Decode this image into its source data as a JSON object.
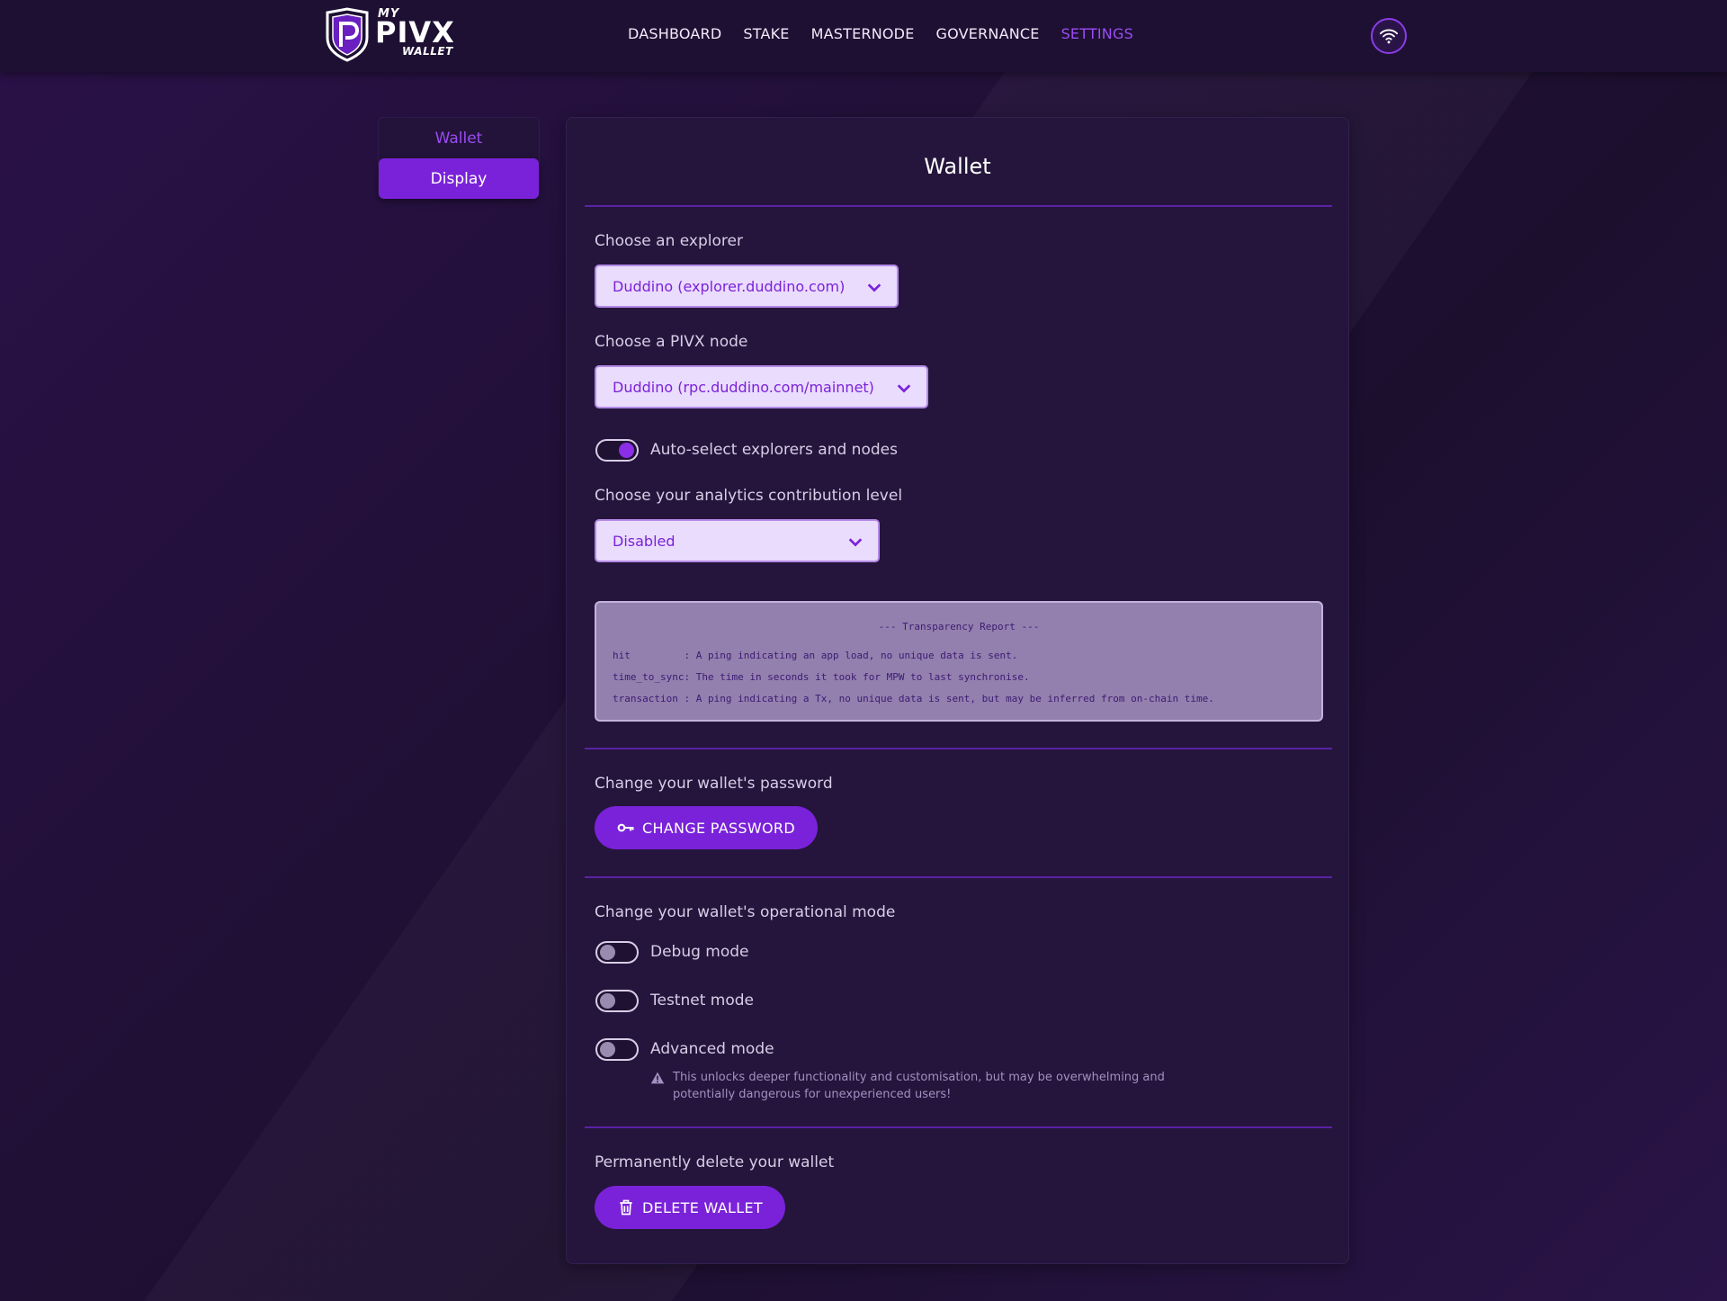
{
  "brand": {
    "my": "MY",
    "name": "PIVX",
    "sub": "WALLET"
  },
  "nav": [
    "DASHBOARD",
    "STAKE",
    "MASTERNODE",
    "GOVERNANCE",
    "SETTINGS"
  ],
  "nav_active": "SETTINGS",
  "sidebar": {
    "wallet": "Wallet",
    "display": "Display"
  },
  "panel": {
    "title": "Wallet",
    "explorer_label": "Choose an explorer",
    "explorer_value": "Duddino (explorer.duddino.com)",
    "node_label": "Choose a PIVX node",
    "node_value": "Duddino (rpc.duddino.com/mainnet)",
    "autoselect_label": "Auto-select explorers and nodes",
    "autoselect_on": true,
    "analytics_label": "Choose your analytics contribution level",
    "analytics_value": "Disabled",
    "report": {
      "title": "--- Transparency Report ---",
      "lines": [
        "hit         : A ping indicating an app load, no unique data is sent.",
        "time_to_sync: The time in seconds it took for MPW to last synchronise.",
        "transaction : A ping indicating a Tx, no unique data is sent, but may be inferred from on-chain time."
      ]
    },
    "password_label": "Change your wallet's password",
    "password_button": "CHANGE PASSWORD",
    "mode_label": "Change your wallet's operational mode",
    "debug_label": "Debug mode",
    "testnet_label": "Testnet mode",
    "advanced_label": "Advanced mode",
    "advanced_warning": "This unlocks deeper functionality and customisation, but may be overwhelming and potentially dangerous for unexperienced users!",
    "delete_label": "Permanently delete your wallet",
    "delete_button": "DELETE WALLET"
  },
  "colors": {
    "accent": "#7a22d9",
    "active_nav": "#9a4cf2",
    "background": "#1e1033"
  },
  "icons": [
    "pivx-shield-logo",
    "wifi-icon",
    "chevron-down-icon",
    "key-icon",
    "warning-icon",
    "trash-icon"
  ]
}
